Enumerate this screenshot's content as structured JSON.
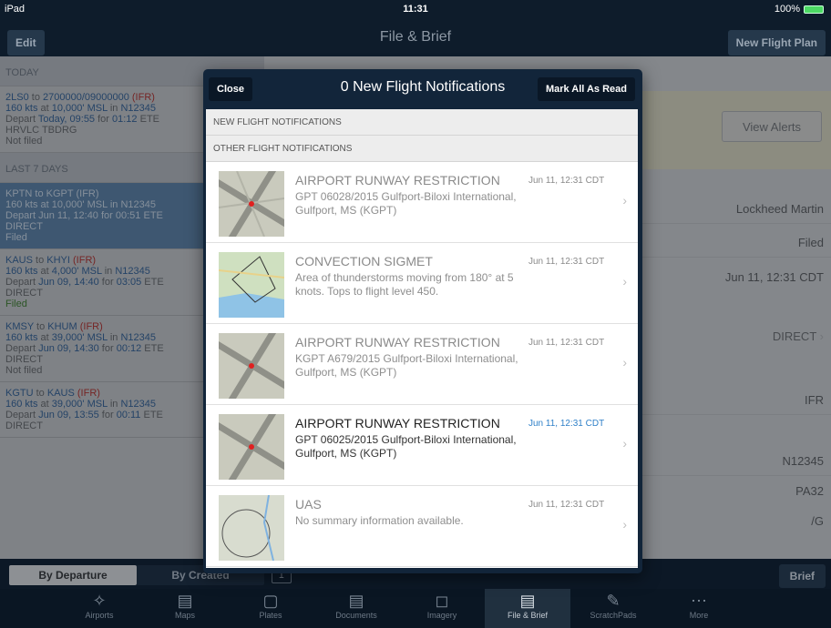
{
  "status": {
    "device": "iPad",
    "time": "11:31",
    "battery": "100%"
  },
  "nav": {
    "edit": "Edit",
    "title": "File & Brief",
    "new_plan": "New Flight Plan"
  },
  "left": {
    "today_header": "TODAY",
    "last7_header": "LAST 7 DAYS",
    "flights": [
      {
        "from": "2LS0",
        "to_word": " to ",
        "to": "2700000/09000000",
        "rules": "(IFR)",
        "line2a": "160 kts",
        "line2b": " at ",
        "alt": "10,000' MSL",
        "line2c": " in ",
        "tail": "N12345",
        "dep_word": "Depart ",
        "dep": "Today, 09:55",
        "for_word": " for ",
        "ete": "01:12",
        "ete_word": " ETE",
        "route": "HRVLC TBDRG",
        "status": "Not filed"
      },
      {
        "from": "KPTN",
        "to_word": " to ",
        "to": "KGPT",
        "rules": "(IFR)",
        "line2a": "160 kts",
        "line2b": " at ",
        "alt": "10,000' MSL",
        "line2c": " in ",
        "tail": "N12345",
        "dep_word": "Depart ",
        "dep": "Jun 11, 12:40",
        "for_word": " for ",
        "ete": "00:51",
        "ete_word": " ETE",
        "route": "DIRECT",
        "status": "Filed"
      },
      {
        "from": "KAUS",
        "to_word": " to ",
        "to": "KHYI",
        "rules": "(IFR)",
        "line2a": "160 kts",
        "line2b": " at ",
        "alt": "4,000' MSL",
        "line2c": " in ",
        "tail": "N12345",
        "dep_word": "Depart ",
        "dep": "Jun 09, 14:40",
        "for_word": " for ",
        "ete": "03:05",
        "ete_word": " ETE",
        "route": "DIRECT",
        "status": "Filed"
      },
      {
        "from": "KMSY",
        "to_word": " to ",
        "to": "KHUM",
        "rules": "(IFR)",
        "line2a": "160 kts",
        "line2b": " at ",
        "alt": "39,000' MSL",
        "line2c": " in ",
        "tail": "N12345",
        "dep_word": "Depart ",
        "dep": "Jun 09, 14:30",
        "for_word": " for ",
        "ete": "00:12",
        "ete_word": " ETE",
        "route": "DIRECT",
        "status": "Not filed"
      },
      {
        "from": "KGTU",
        "to_word": " to ",
        "to": "KAUS",
        "rules": "(IFR)",
        "line2a": "160 kts",
        "line2b": " at ",
        "alt": "39,000' MSL",
        "line2c": " in ",
        "tail": "N12345",
        "dep_word": "Depart ",
        "dep": "Jun 09, 13:55",
        "for_word": " for ",
        "ete": "00:11",
        "ete_word": " ETE",
        "route": "DIRECT",
        "status": ""
      }
    ]
  },
  "right": {
    "view_alerts": "View Alerts",
    "operator": "Lockheed Martin",
    "filed": "Filed",
    "filed_time": "Jun 11, 12:31 CDT",
    "route": "DIRECT",
    "rules": "IFR",
    "tail": "N12345",
    "type": "PA32",
    "equip": "/G"
  },
  "bottom": {
    "by_departure": "By Departure",
    "by_created": "By Created",
    "brief": "Brief"
  },
  "tabs": [
    {
      "label": "Airports",
      "icon": "airport-icon"
    },
    {
      "label": "Maps",
      "icon": "map-icon"
    },
    {
      "label": "Plates",
      "icon": "plates-icon"
    },
    {
      "label": "Documents",
      "icon": "documents-icon"
    },
    {
      "label": "Imagery",
      "icon": "imagery-icon"
    },
    {
      "label": "File & Brief",
      "icon": "file-brief-icon"
    },
    {
      "label": "ScratchPads",
      "icon": "scratchpad-icon"
    },
    {
      "label": "More",
      "icon": "more-icon"
    }
  ],
  "popover": {
    "close": "Close",
    "title": "0 New Flight Notifications",
    "mark_all": "Mark All As Read",
    "new_section": "NEW FLIGHT NOTIFICATIONS",
    "other_section": "OTHER FLIGHT NOTIFICATIONS",
    "items": [
      {
        "title": "AIRPORT RUNWAY RESTRICTION",
        "desc": "GPT 06028/2015 Gulfport-Biloxi International, Gulfport, MS (KGPT)",
        "date": "Jun 11, 12:31 CDT",
        "unread": false
      },
      {
        "title": "CONVECTION SIGMET",
        "desc": "Area of thunderstorms moving from 180° at 5 knots. Tops to flight level 450.",
        "date": "Jun 11, 12:31 CDT",
        "unread": false
      },
      {
        "title": "AIRPORT RUNWAY RESTRICTION",
        "desc": "KGPT A679/2015 Gulfport-Biloxi International, Gulfport, MS (KGPT)",
        "date": "Jun 11, 12:31 CDT",
        "unread": false
      },
      {
        "title": "AIRPORT RUNWAY RESTRICTION",
        "desc": "GPT 06025/2015 Gulfport-Biloxi International, Gulfport, MS (KGPT)",
        "date": "Jun 11, 12:31 CDT",
        "unread": true
      },
      {
        "title": "UAS",
        "desc": "No summary information available.",
        "date": "Jun 11, 12:31 CDT",
        "unread": false
      }
    ]
  }
}
